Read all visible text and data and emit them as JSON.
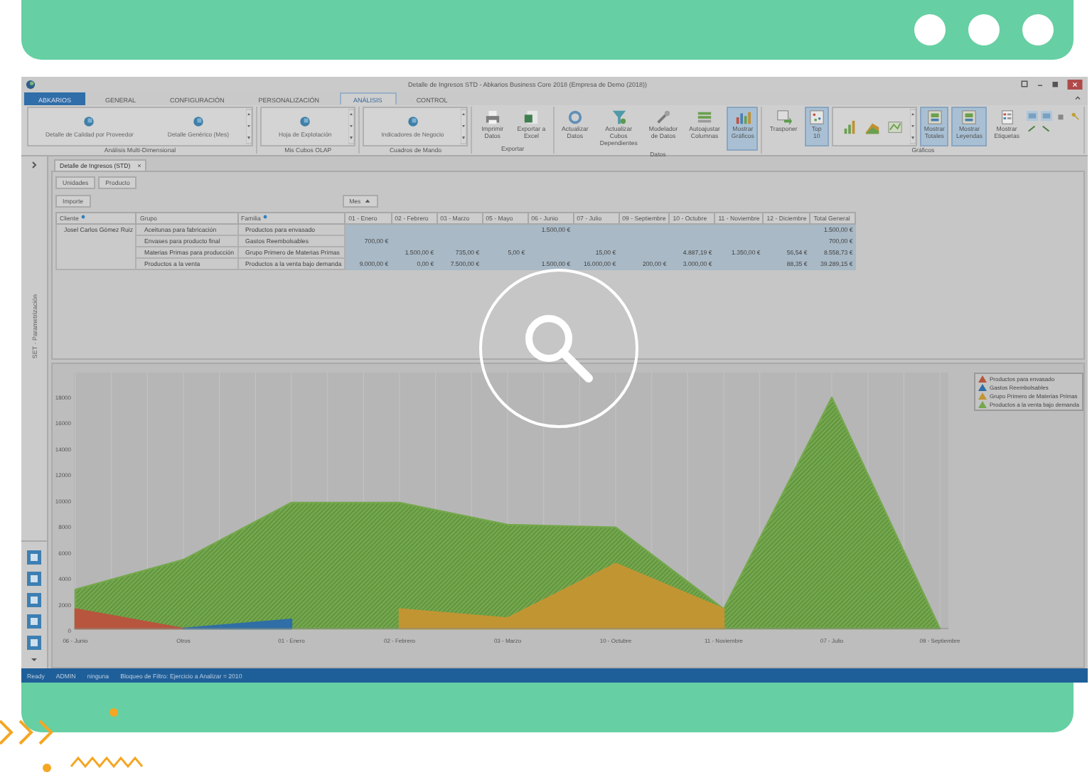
{
  "window": {
    "title": "Detalle de Ingresos STD - Abkarios Business Core 2018 (Empresa de Demo (2018))"
  },
  "ribbon": {
    "tabs": [
      {
        "label": "ABKARIOS",
        "kind": "app",
        "selected": false
      },
      {
        "label": "GENERAL",
        "kind": "tab",
        "selected": false
      },
      {
        "label": "CONFIGURACIÓN",
        "kind": "tab",
        "selected": false
      },
      {
        "label": "PERSONALIZACIÓN",
        "kind": "tab",
        "selected": false
      },
      {
        "label": "ANÁLISIS",
        "kind": "tab",
        "selected": true
      },
      {
        "label": "CONTROL",
        "kind": "tab",
        "selected": false
      }
    ],
    "groups": [
      {
        "title": "Análisis Multi-Dimensional",
        "items": [
          {
            "kind": "gallery",
            "entries": [
              "Detalle de Calidad por Proveedor",
              "Detalle Genérico (Mes)"
            ]
          }
        ]
      },
      {
        "title": "Mis Cubos OLAP",
        "items": [
          {
            "kind": "gallery",
            "entries": [
              "Hoja de Explotación"
            ]
          }
        ]
      },
      {
        "title": "Cuadros de Mando",
        "items": [
          {
            "kind": "gallery",
            "entries": [
              "Indicadores de Negocio"
            ]
          }
        ]
      },
      {
        "title": "Exportar",
        "items": [
          {
            "kind": "button",
            "label": "Imprimir Datos",
            "selected": false
          },
          {
            "kind": "button",
            "label": "Exportar a Excel",
            "selected": false
          }
        ]
      },
      {
        "title": "Datos",
        "items": [
          {
            "kind": "button",
            "label": "Actualizar Datos",
            "selected": false
          },
          {
            "kind": "button",
            "label": "Actualizar Cubos Dependientes",
            "selected": false
          },
          {
            "kind": "button",
            "label": "Modelador de Datos",
            "selected": false
          },
          {
            "kind": "button",
            "label": "Autoajustar Columnas",
            "selected": false
          },
          {
            "kind": "button",
            "label": "Mostrar Gráficos",
            "selected": true
          }
        ]
      },
      {
        "title": "Gráficos",
        "items": [
          {
            "kind": "button",
            "label": "Trasponer",
            "selected": false
          },
          {
            "kind": "button",
            "label": "Top 10",
            "selected": true
          },
          {
            "kind": "chart-gallery"
          },
          {
            "kind": "button",
            "label": "Mostrar Totales",
            "selected": true
          },
          {
            "kind": "button",
            "label": "Mostrar Leyendas",
            "selected": true
          },
          {
            "kind": "button",
            "label": "Mostrar Etiquetas",
            "selected": false
          },
          {
            "kind": "small-tools"
          }
        ]
      }
    ]
  },
  "document_tab": {
    "label": "Detalle de Ingresos (STD)",
    "close": "×"
  },
  "side_panel": {
    "title": "SET · Parametrización"
  },
  "pivot": {
    "filter_fields": [
      "Unidades",
      "Producto"
    ],
    "data_fields": [
      "Importe"
    ],
    "column_fields": [
      "Mes"
    ],
    "row_headers": [
      {
        "label": "Cliente",
        "filtered": true
      },
      {
        "label": "Grupo",
        "filtered": false
      },
      {
        "label": "Familia",
        "filtered": true
      }
    ],
    "columns": [
      "01 - Enero",
      "02 - Febrero",
      "03 - Marzo",
      "05 - Mayo",
      "06 - Junio",
      "07 - Julio",
      "09 - Septiembre",
      "10 - Octubre",
      "11 - Noviembre",
      "12 - Diciembre",
      "Total General"
    ],
    "rows": [
      {
        "cliente": "Josel Carlos Gómez Ruiz",
        "grupo": "Aceitunas para fabricación",
        "familia": "Productos para envasado",
        "cells": [
          null,
          null,
          null,
          null,
          "1.500,00 €",
          null,
          null,
          null,
          null,
          null,
          "1.500,00 €"
        ]
      },
      {
        "grupo": "Envases para producto final",
        "familia": "Gastos Reembolsables",
        "cells": [
          "700,00 €",
          null,
          null,
          null,
          null,
          null,
          null,
          null,
          null,
          null,
          "700,00 €"
        ]
      },
      {
        "grupo": "Materias Primas para producción",
        "familia": "Grupo Primero de Materias Primas",
        "cells": [
          null,
          "1.500,00 €",
          "735,00 €",
          "5,00 €",
          null,
          "15,00 €",
          null,
          "4.887,19 €",
          "1.350,00 €",
          "56,54 €",
          "8.558,73 €"
        ]
      },
      {
        "grupo": "Productos a la venta",
        "familia": "Productos a la venta bajo demanda",
        "cells": [
          "9.000,00 €",
          "0,00 €",
          "7.500,00 €",
          null,
          "1.500,00 €",
          "16.000,00 €",
          "200,00 €",
          "3.000,00 €",
          null,
          "88,35 €",
          "39.289,15 €"
        ]
      }
    ]
  },
  "chart": {
    "chart_data": {
      "type": "area",
      "categories": [
        "06 - Junio",
        "Otros",
        "01 - Enero",
        "02 - Febrero",
        "03 - Marzo",
        "10 - Octubre",
        "11 - Noviembre",
        "07 - Julio",
        "09 - Septiembre"
      ],
      "series": [
        {
          "name": "Productos a la venta bajo demanda",
          "color": "#74a84c",
          "values": [
            3000,
            5300,
            9700,
            9700,
            8000,
            7800,
            1500,
            17800,
            0
          ]
        },
        {
          "name": "Productos para envasado",
          "color": "#b8553e",
          "values": [
            1500,
            0,
            null,
            null,
            null,
            null,
            null,
            null,
            null
          ]
        },
        {
          "name": "Gastos Reembolsables",
          "color": "#2f6ea6",
          "values": [
            null,
            0,
            700,
            null,
            null,
            null,
            null,
            null,
            null
          ]
        },
        {
          "name": "Grupo Primero de Materias Primas",
          "color": "#c29533",
          "values": [
            null,
            null,
            null,
            1500,
            800,
            5000,
            1500,
            null,
            null
          ]
        }
      ],
      "grid": true,
      "ylim": [
        0,
        19500
      ],
      "yticks": [
        0,
        2000,
        4000,
        6000,
        8000,
        10000,
        12000,
        14000,
        16000,
        18000
      ]
    }
  },
  "status_bar": [
    "Ready",
    "ADMIN",
    "ninguna",
    "Bloqueo de Filtro: Ejercicio a Analizar = 2010"
  ]
}
